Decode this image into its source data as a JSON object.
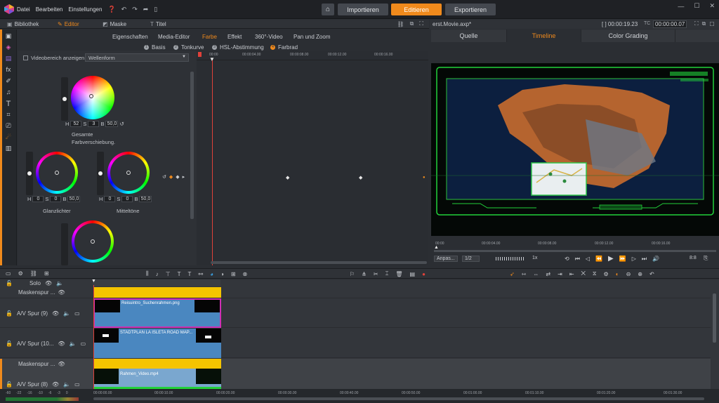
{
  "menu": [
    "Datei",
    "Bearbeiten",
    "Einstellungen"
  ],
  "modes": {
    "import": "Importieren",
    "edit": "Editieren",
    "export": "Exportieren"
  },
  "left_tabs": [
    "Bibliothek",
    "Editor",
    "Maske",
    "Titel"
  ],
  "prop_tabs": [
    "Eigenschaften",
    "Media-Editor",
    "Farbe",
    "Effekt",
    "360°-Video",
    "Pan und Zoom"
  ],
  "color_modes": [
    "Basis",
    "Tonkurve",
    "HSL-Abstimmung",
    "Farbrad"
  ],
  "color_mode_numbers": [
    "1",
    "2",
    "3",
    "4"
  ],
  "video_range_label": "Videobereich anzeigen",
  "waveform_select": "Wellenform",
  "wheels": {
    "global": {
      "h": "52",
      "s": "3",
      "b": "50,0",
      "label": "Gesamte Farbverschiebung."
    },
    "highlights": {
      "h": "0",
      "s": "0",
      "b": "50,0",
      "label": "Glanzlichter"
    },
    "midtones": {
      "h": "0",
      "s": "0",
      "b": "50,0",
      "label": "Mitteltöne"
    }
  },
  "hsb_labels": {
    "h": "H",
    "s": "S",
    "b": "B"
  },
  "kf_ruler": [
    "00:00",
    "00:00:04.00",
    "00:00:08.00",
    "00:00:12.00",
    "00:00:16.00"
  ],
  "project": {
    "name": "erst.Movie.axp*",
    "time_total": "[ ] 00:00:19.23",
    "tc_label": "TC",
    "tc": "00:00:00.07"
  },
  "right_tabs": [
    "Quelle",
    "Timeline",
    "Color Grading"
  ],
  "player": {
    "ruler": [
      "00:00",
      "00:00:04.00",
      "00:00:08.00",
      "00:00:12.00",
      "00:00:16.00"
    ],
    "fit": "Anpas...",
    "fraction": "1/2",
    "speed": "1x",
    "zoom_readout": "8:8"
  },
  "tracks": [
    {
      "name": "Solo"
    },
    {
      "name": "Maskenspur ..."
    },
    {
      "name": "A/V Spur (9)",
      "clip": "Reisuintro_Suchenrahmen.png"
    },
    {
      "name": "A/V Spur (10...",
      "clip": "STADTPLAN LA ISLETA ROAD MAP..."
    },
    {
      "name": "Maskenspur ..."
    },
    {
      "name": "A/V Spur (8)",
      "clip": "Rahmen_Video.mp4"
    }
  ],
  "bottom_ruler": [
    "00:00:00.00",
    "00:00:10.00",
    "00:00:20.00",
    "00:00:30.00",
    "00:00:40.00",
    "00:00:50.00",
    "00:01:00.00",
    "00:01:10.00",
    "00:01:20.00",
    "00:01:30.00"
  ],
  "level_meter": [
    "-60",
    "-22",
    "-16",
    "-10",
    "-6",
    "-3",
    "0"
  ],
  "colors": {
    "accent": "#f08a1c",
    "yellow_clip": "#f5c400",
    "blue_clip": "#4a87c0",
    "magenta": "#d02fb4",
    "hud_green": "#22d13a"
  }
}
